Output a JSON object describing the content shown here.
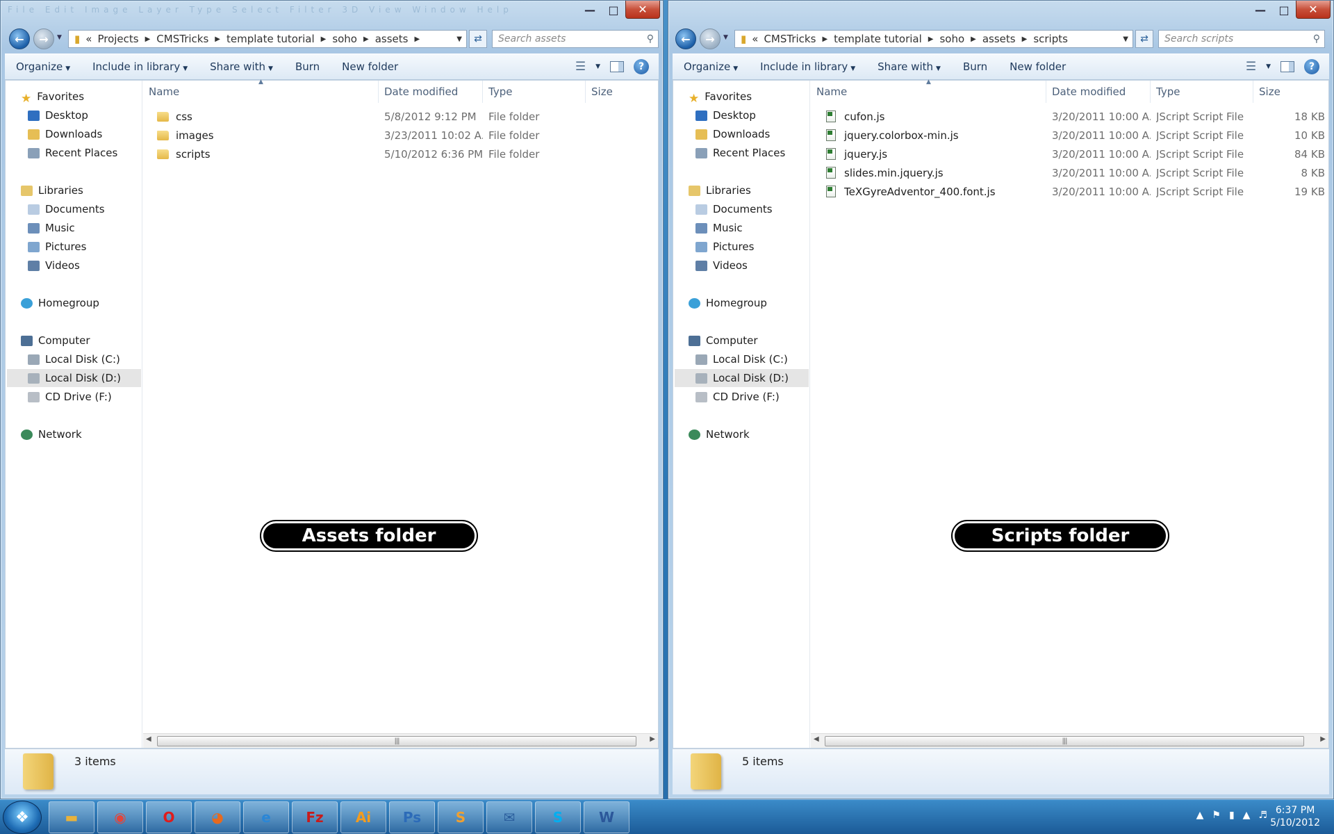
{
  "left_window": {
    "title_menu_wash": "File Edit Image Layer Type Select Filter 3D View Window Help",
    "address": {
      "prefix": "«",
      "crumbs": [
        "Projects",
        "CMSTricks",
        "template tutorial",
        "soho",
        "assets"
      ]
    },
    "search_placeholder": "Search assets",
    "toolbar": {
      "organize": "Organize",
      "include_in_library": "Include in library",
      "share_with": "Share with",
      "burn": "Burn",
      "new_folder": "New folder"
    },
    "columns": {
      "name": "Name",
      "date": "Date modified",
      "type": "Type",
      "size": "Size"
    },
    "files": [
      {
        "name": "css",
        "date": "5/8/2012 9:12 PM",
        "type": "File folder",
        "size": ""
      },
      {
        "name": "images",
        "date": "3/23/2011 10:02 A...",
        "type": "File folder",
        "size": ""
      },
      {
        "name": "scripts",
        "date": "5/10/2012 6:36 PM",
        "type": "File folder",
        "size": ""
      }
    ],
    "label": "Assets folder",
    "status_count": "3 items"
  },
  "right_window": {
    "address": {
      "prefix": "«",
      "crumbs": [
        "CMSTricks",
        "template tutorial",
        "soho",
        "assets",
        "scripts"
      ]
    },
    "search_placeholder": "Search scripts",
    "toolbar": {
      "organize": "Organize",
      "include_in_library": "Include in library",
      "share_with": "Share with",
      "burn": "Burn",
      "new_folder": "New folder"
    },
    "columns": {
      "name": "Name",
      "date": "Date modified",
      "type": "Type",
      "size": "Size"
    },
    "files": [
      {
        "name": "cufon.js",
        "date": "3/20/2011 10:00 A...",
        "type": "JScript Script File",
        "size": "18 KB"
      },
      {
        "name": "jquery.colorbox-min.js",
        "date": "3/20/2011 10:00 A...",
        "type": "JScript Script File",
        "size": "10 KB"
      },
      {
        "name": "jquery.js",
        "date": "3/20/2011 10:00 A...",
        "type": "JScript Script File",
        "size": "84 KB"
      },
      {
        "name": "slides.min.jquery.js",
        "date": "3/20/2011 10:00 A...",
        "type": "JScript Script File",
        "size": "8 KB"
      },
      {
        "name": "TeXGyreAdventor_400.font.js",
        "date": "3/20/2011 10:00 A...",
        "type": "JScript Script File",
        "size": "19 KB"
      }
    ],
    "label": "Scripts folder",
    "status_count": "5 items"
  },
  "nav": {
    "favorites": "Favorites",
    "desktop": "Desktop",
    "downloads": "Downloads",
    "recent_places": "Recent Places",
    "libraries": "Libraries",
    "documents": "Documents",
    "music": "Music",
    "pictures": "Pictures",
    "videos": "Videos",
    "homegroup": "Homegroup",
    "computer": "Computer",
    "local_c": "Local Disk (C:)",
    "local_d": "Local Disk (D:)",
    "cd_drive": "CD Drive (F:)",
    "network": "Network"
  },
  "taskbar": {
    "apps": [
      {
        "icon": "windows-explorer-icon",
        "glyph": "▬",
        "color": "#e8b23c"
      },
      {
        "icon": "chrome-icon",
        "glyph": "◉",
        "color": "#e2453c"
      },
      {
        "icon": "opera-icon",
        "glyph": "O",
        "color": "#e01b1b"
      },
      {
        "icon": "firefox-icon",
        "glyph": "◕",
        "color": "#e66a1f"
      },
      {
        "icon": "internet-explorer-icon",
        "glyph": "e",
        "color": "#2a86d6"
      },
      {
        "icon": "filezilla-icon",
        "glyph": "Fz",
        "color": "#c81b1b"
      },
      {
        "icon": "illustrator-icon",
        "glyph": "Ai",
        "color": "#f39c1f"
      },
      {
        "icon": "photoshop-icon",
        "glyph": "Ps",
        "color": "#2c6bb8"
      },
      {
        "icon": "sublime-text-icon",
        "glyph": "S",
        "color": "#f0a030"
      },
      {
        "icon": "thunderbird-icon",
        "glyph": "✉",
        "color": "#2a5d9c"
      },
      {
        "icon": "skype-icon",
        "glyph": "S",
        "color": "#00aff0"
      },
      {
        "icon": "word-icon",
        "glyph": "W",
        "color": "#2b579a"
      }
    ],
    "time": "6:37 PM",
    "date": "5/10/2012"
  }
}
